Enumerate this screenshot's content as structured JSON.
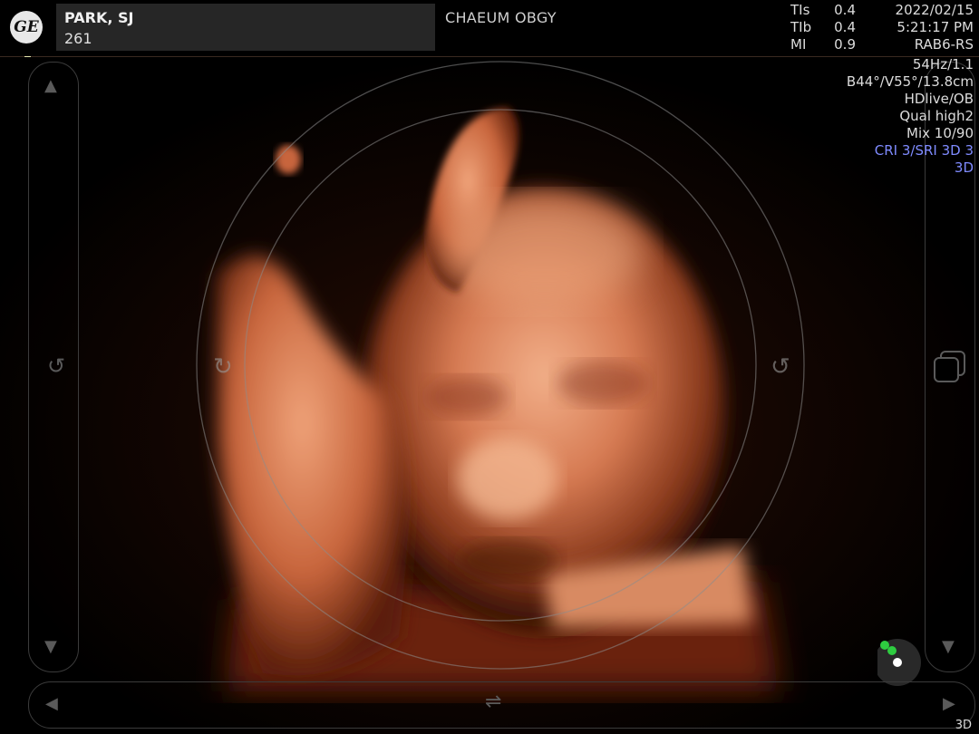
{
  "header": {
    "logo_text": "GE",
    "patient_name": "PARK, SJ",
    "patient_id": "261",
    "institution": "CHAEUM OBGY",
    "indices": [
      {
        "label": "TIs",
        "value": "0.4"
      },
      {
        "label": "TIb",
        "value": "0.4"
      },
      {
        "label": "MI",
        "value": "0.9"
      }
    ],
    "date": "2022/02/15",
    "time": "5:21:17 PM",
    "probe": "RAB6-RS"
  },
  "params": {
    "frame_rate": "54Hz/1.1",
    "angles": "B44°/V55°/13.8cm",
    "render_mode": "HDlive/OB",
    "quality": "Qual high2",
    "mix": "Mix 10/90",
    "cri_sri": "CRI 3/SRI 3D 3",
    "mode": "3D"
  },
  "footer": {
    "mode_label": "3D"
  },
  "icons": [
    "ge-logo-icon",
    "up-arrow-icon",
    "down-arrow-icon",
    "rotate-left-icon",
    "rotate-right-icon",
    "layers-icon",
    "left-arrow-icon",
    "right-arrow-icon",
    "rotate-horizontal-icon",
    "light-source-icon"
  ],
  "colors": {
    "accent_blue": "#7f8bff",
    "light_marker_green": "#2ecc40",
    "render_orange": "#d9825a"
  }
}
